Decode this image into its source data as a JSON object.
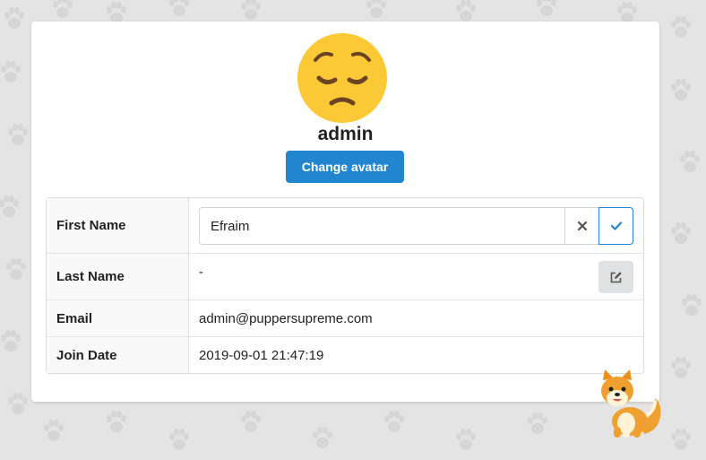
{
  "profile": {
    "username": "admin",
    "change_avatar_label": "Change avatar",
    "avatar_icon": "pensive-face-emoji",
    "mascot_icon": "shiba-dog-emoji"
  },
  "fields": {
    "first_name": {
      "label": "First Name",
      "value": "Efraim"
    },
    "last_name": {
      "label": "Last Name",
      "value": "-"
    },
    "email": {
      "label": "Email",
      "value": "admin@puppersupreme.com"
    },
    "join_date": {
      "label": "Join Date",
      "value": "2019-09-01 21:47:19"
    }
  },
  "colors": {
    "primary": "#2185d0",
    "background": "#e4e4e4",
    "avatar_yellow": "#fbc935"
  }
}
